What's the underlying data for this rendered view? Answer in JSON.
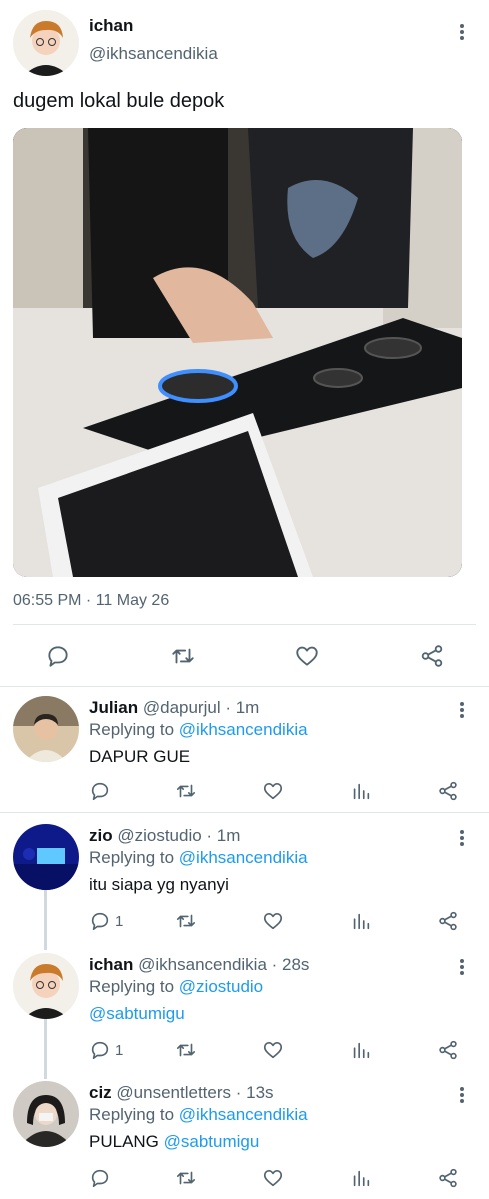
{
  "main_tweet": {
    "name": "ichan",
    "handle": "@ikhsancendikia",
    "text": "dugem lokal bule depok",
    "timestamp": "06:55 PM · 11 May 26",
    "actions": [
      "reply-icon",
      "retweet-icon",
      "like-icon",
      "share-icon"
    ]
  },
  "replies": [
    {
      "name": "Julian",
      "meta": "@dapurjul · 1m",
      "replying_prefix": "Replying to ",
      "replying_to": "@ikhsancendikia",
      "text": "DAPUR GUE",
      "text_mention": "",
      "reply_count": ""
    },
    {
      "name": "zio",
      "meta": "@ziostudio · 1m",
      "replying_prefix": "Replying to ",
      "replying_to": "@ikhsancendikia",
      "text": "itu siapa yg nyanyi",
      "text_mention": "",
      "reply_count": "1"
    },
    {
      "name": "ichan",
      "meta": "@ikhsancendikia · 28s",
      "replying_prefix": "Replying to ",
      "replying_to": "@ziostudio",
      "text": "",
      "text_mention": "@sabtumigu",
      "reply_count": "1"
    },
    {
      "name": "ciz",
      "meta": "@unsentletters · 13s",
      "replying_prefix": "Replying to ",
      "replying_to": "@ikhsancendikia",
      "text": "PULANG ",
      "text_mention": "@sabtumigu",
      "reply_count": ""
    }
  ],
  "colors": {
    "link": "#1d9bf0",
    "secondary_text": "#536471",
    "divider": "#e1e6ea"
  }
}
